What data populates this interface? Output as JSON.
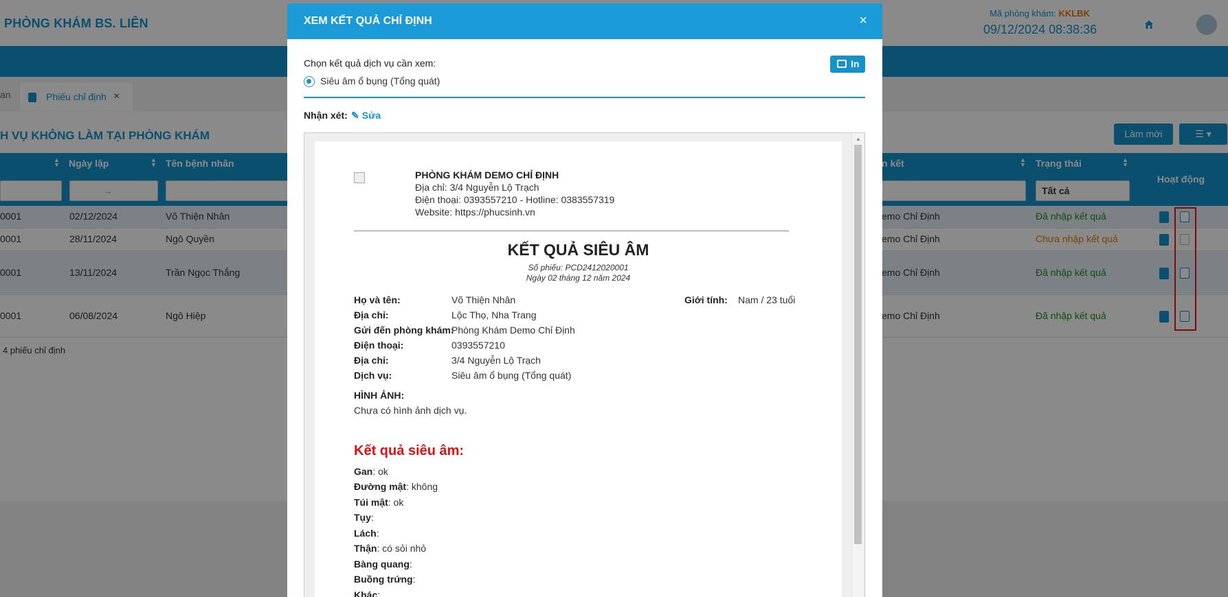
{
  "app": {
    "clinic_name": "PHÒNG KHÁM BS. LIÊN",
    "clinic_code_label": "Mã phòng khám:",
    "clinic_code": "KKLBK",
    "datetime": "09/12/2024 08:38:36"
  },
  "tabs": {
    "prev_tab_fragment": "an",
    "active_tab": "Phiếu chỉ định",
    "close_glyph": "×"
  },
  "page": {
    "section_title": "H VỤ KHÔNG LÀM TẠI PHÒNG KHÁM",
    "new_button": "Làm mới",
    "view_button": "☰ ▾"
  },
  "table": {
    "headers": {
      "date": "Ngày lập",
      "patient": "Tên bệnh nhân",
      "linked": "n kết",
      "status": "Trạng thái",
      "actions": "Hoạt động"
    },
    "filters": {
      "date_range": "→",
      "status_select": "Tất cả"
    },
    "rows": [
      {
        "code": "0001",
        "date": "02/12/2024",
        "patient": "Võ Thiện Nhân",
        "linked": "emo Chỉ Định",
        "status": "Đã nhập kết quả"
      },
      {
        "code": "0001",
        "date": "28/11/2024",
        "patient": "Ngô Quyền",
        "linked": "emo Chỉ Định",
        "status": "Chưa nhập kết quả"
      },
      {
        "code": "0001",
        "date": "13/11/2024",
        "patient": "Trần Ngọc Thắng",
        "linked": "emo Chỉ Định",
        "status": "Đã nhập kết quả"
      },
      {
        "code": "0001",
        "date": "06/08/2024",
        "patient": "Ngô Hiệp",
        "linked": "emo Chỉ Định",
        "status": "Đã nhập kết quả"
      }
    ],
    "row_count": "4 phiếu chỉ định"
  },
  "modal": {
    "title": "XEM KẾT QUẢ CHỈ ĐỊNH",
    "close_glyph": "×",
    "choose_label": "Chọn kết quả dịch vụ cần xem:",
    "service_option": "Siêu âm ổ bụng (Tổng quát)",
    "print_button": "In",
    "comment_label": "Nhận xét:",
    "edit_link": "Sửa"
  },
  "document": {
    "clinic_name": "PHÒNG KHÁM DEMO CHỈ ĐỊNH",
    "address_line": "Địa chỉ: 3/4 Nguyễn Lộ Trạch",
    "phone_line": "Điện thoại: 0393557210 - Hotline: 0383557319",
    "website_line": "Website: https://phucsinh.vn",
    "heading": "KẾT QUẢ SIÊU ÂM",
    "ticket_no": "Số phiếu: PCD2412020001",
    "date_line": "Ngày 02 tháng 12 năm 2024",
    "info": {
      "name_label": "Họ và tên:",
      "name": "Võ Thiện Nhân",
      "gender_label": "Giới tính:",
      "gender": "Nam / 23 tuổi",
      "address_label": "Địa chỉ:",
      "address": "Lộc Thọ, Nha Trang",
      "sent_to_label": "Gửi đến phòng khám:",
      "sent_to": "Phòng Khám Demo Chỉ Định",
      "phone_label": "Điện thoại:",
      "phone": "0393557210",
      "address2_label": "Địa chỉ:",
      "address2": "3/4 Nguyễn Lộ Trạch",
      "service_label": "Dịch vụ:",
      "service": "Siêu âm ổ bụng (Tổng quát)"
    },
    "images_title": "HÌNH ẢNH:",
    "images_text": "Chưa có hình ảnh dịch vụ.",
    "result_title": "Kết quả siêu âm:",
    "results": [
      {
        "label": "Gan",
        "value": ": ok"
      },
      {
        "label": "Đường mật",
        "value": ": không"
      },
      {
        "label": "Túi mật",
        "value": ": ok"
      },
      {
        "label": "Tụy",
        "value": ":"
      },
      {
        "label": "Lách",
        "value": ":"
      },
      {
        "label": "Thận",
        "value": ": có sỏi nhỏ"
      },
      {
        "label": "Bàng quang",
        "value": ":"
      },
      {
        "label": "Buồng trứng",
        "value": ":"
      },
      {
        "label": "Khác",
        "value": ":"
      }
    ]
  },
  "colors": {
    "primary": "#1592cc",
    "header_blue": "#1a9ad6",
    "done_green": "#1e8c1e",
    "pending_orange": "#e07a00",
    "result_red": "#e01010",
    "highlight_red": "#e11111"
  }
}
